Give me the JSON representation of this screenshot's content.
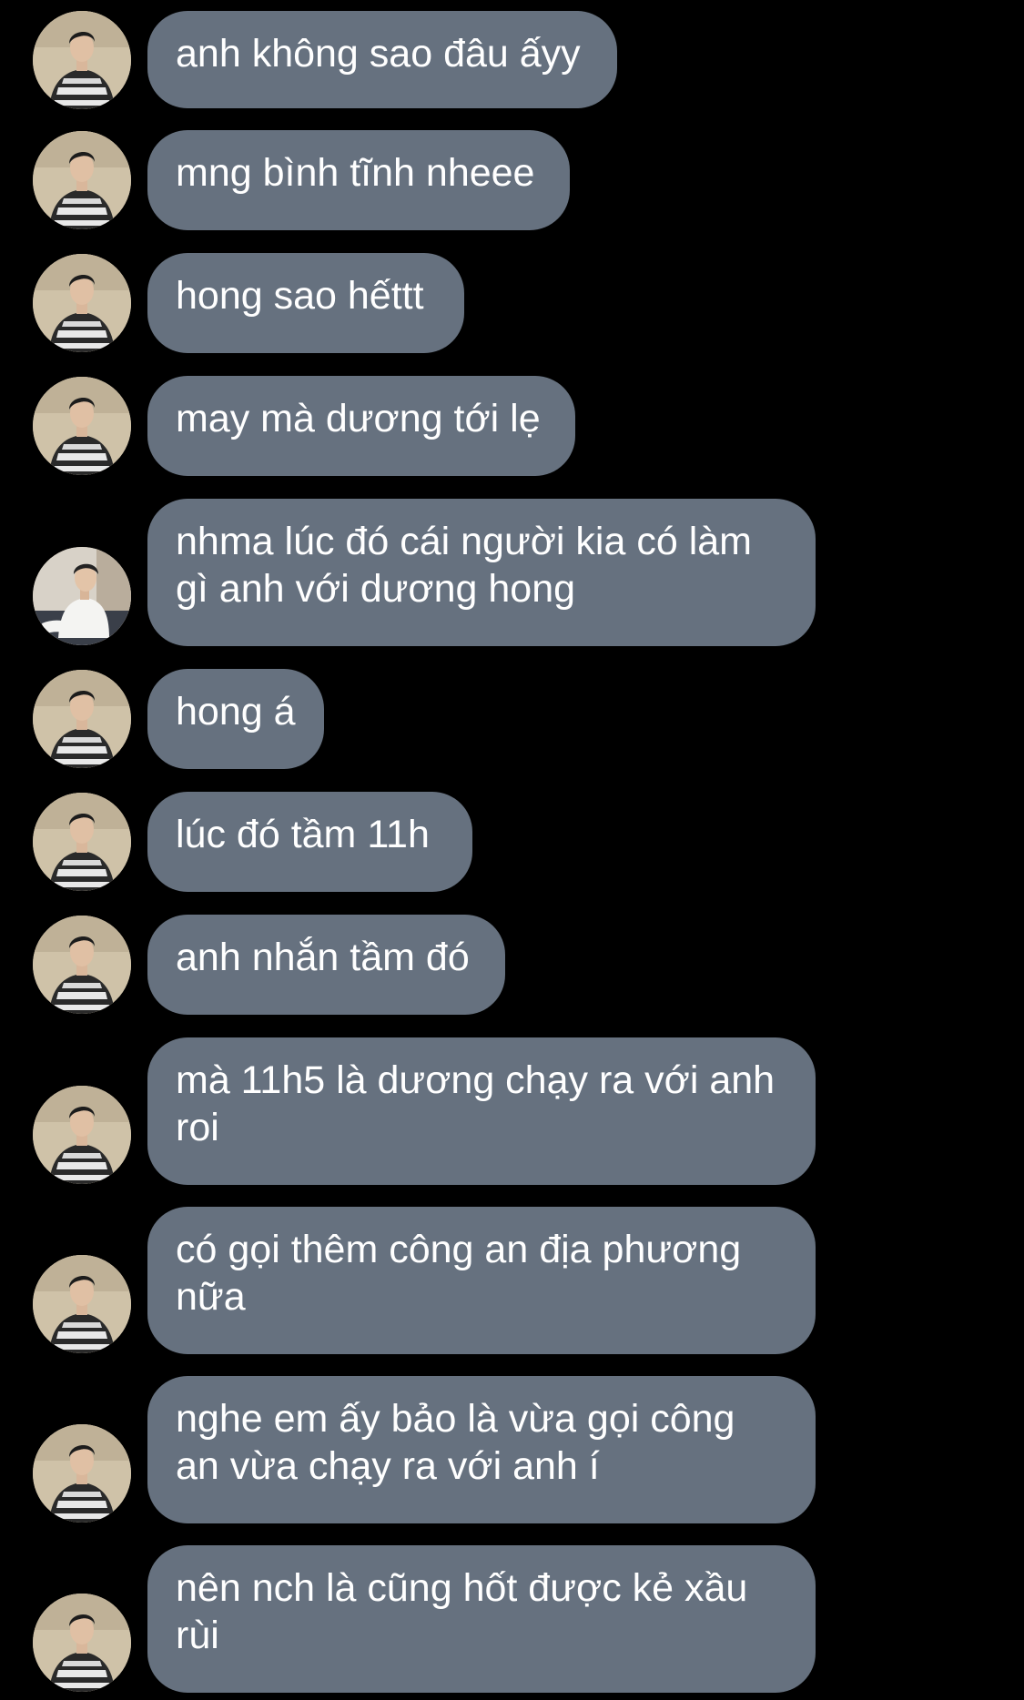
{
  "colors": {
    "background": "#000000",
    "bubble": "#66717f",
    "text": "#ffffff"
  },
  "messages": [
    {
      "text": "anh không sao đâu ấyy",
      "avatar": "avatar-striped-sweater-icon"
    },
    {
      "text": "mng bình tĩnh nheee",
      "avatar": "avatar-striped-sweater-icon"
    },
    {
      "text": "hong sao hếttt",
      "avatar": "avatar-striped-sweater-icon"
    },
    {
      "text": "may mà dương tới lẹ",
      "avatar": "avatar-striped-sweater-icon"
    },
    {
      "text": "nhma lúc đó cái người kia có làm gì anh với dương hong",
      "avatar": "avatar-white-shirt-icon"
    },
    {
      "text": "hong á",
      "avatar": "avatar-striped-sweater-icon"
    },
    {
      "text": "lúc đó tầm 11h",
      "avatar": "avatar-striped-sweater-icon"
    },
    {
      "text": "anh nhắn tầm đó",
      "avatar": "avatar-striped-sweater-icon"
    },
    {
      "text": "mà 11h5 là dương chạy ra với anh roi",
      "avatar": "avatar-striped-sweater-icon"
    },
    {
      "text": "có gọi thêm công an địa phương nữa",
      "avatar": "avatar-striped-sweater-icon"
    },
    {
      "text": "nghe em ấy bảo là vừa gọi công an vừa chạy ra với anh í",
      "avatar": "avatar-striped-sweater-icon"
    },
    {
      "text": "nên nch là cũng hốt được kẻ xầu rùi",
      "avatar": "avatar-striped-sweater-icon"
    }
  ]
}
